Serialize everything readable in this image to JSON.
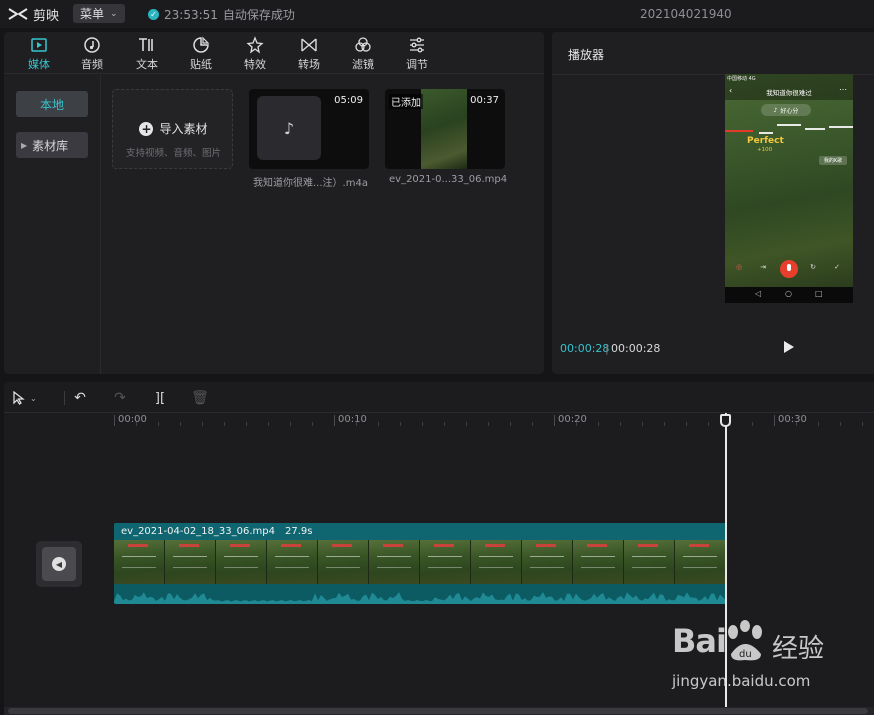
{
  "titlebar": {
    "app_name": "剪映",
    "menu_label": "菜单",
    "save_time": "23:53:51",
    "save_status": "自动保存成功",
    "project_name": "202104021940"
  },
  "media_panel": {
    "tabs": [
      {
        "label": "媒体",
        "icon": "media-icon",
        "active": true
      },
      {
        "label": "音频",
        "icon": "audio-icon"
      },
      {
        "label": "文本",
        "icon": "text-icon"
      },
      {
        "label": "贴纸",
        "icon": "sticker-icon"
      },
      {
        "label": "特效",
        "icon": "effects-icon"
      },
      {
        "label": "转场",
        "icon": "transition-icon"
      },
      {
        "label": "滤镜",
        "icon": "filter-icon"
      },
      {
        "label": "调节",
        "icon": "adjust-icon"
      }
    ],
    "side": {
      "local": "本地",
      "library": "素材库"
    },
    "import": {
      "label": "导入素材",
      "hint": "支持视频、音频、图片"
    },
    "clips": [
      {
        "name": "我知道你很难...注）.m4a",
        "duration": "05:09",
        "type": "audio"
      },
      {
        "name": "ev_2021-0...33_06.mp4",
        "duration": "00:37",
        "badge": "已添加",
        "type": "video"
      }
    ]
  },
  "player": {
    "title": "播放器",
    "time_current": "00:00:28",
    "time_separator": "|",
    "time_total": "00:00:28",
    "preview": {
      "status_text": "中国移动 4G",
      "song_title": "我知道你很难过",
      "lyric_pill": "好心分",
      "perfect_label": "Perfect",
      "score": "+100",
      "right_pill": "我的K歌",
      "nav_icons": [
        "◁",
        "○",
        "□"
      ]
    }
  },
  "timeline": {
    "ruler_labels": [
      "00:00",
      "00:10",
      "00:20",
      "00:30"
    ],
    "clip": {
      "name": "ev_2021-04-02_18_33_06.mp4",
      "duration": "27.9s"
    },
    "colors": {
      "accent": "#37c6d0",
      "clip_bg": "#0c5b63"
    }
  },
  "watermark": {
    "brand": "Bai",
    "brand_suffix": "du",
    "product": "经验",
    "url": "jingyan.baidu.com"
  }
}
